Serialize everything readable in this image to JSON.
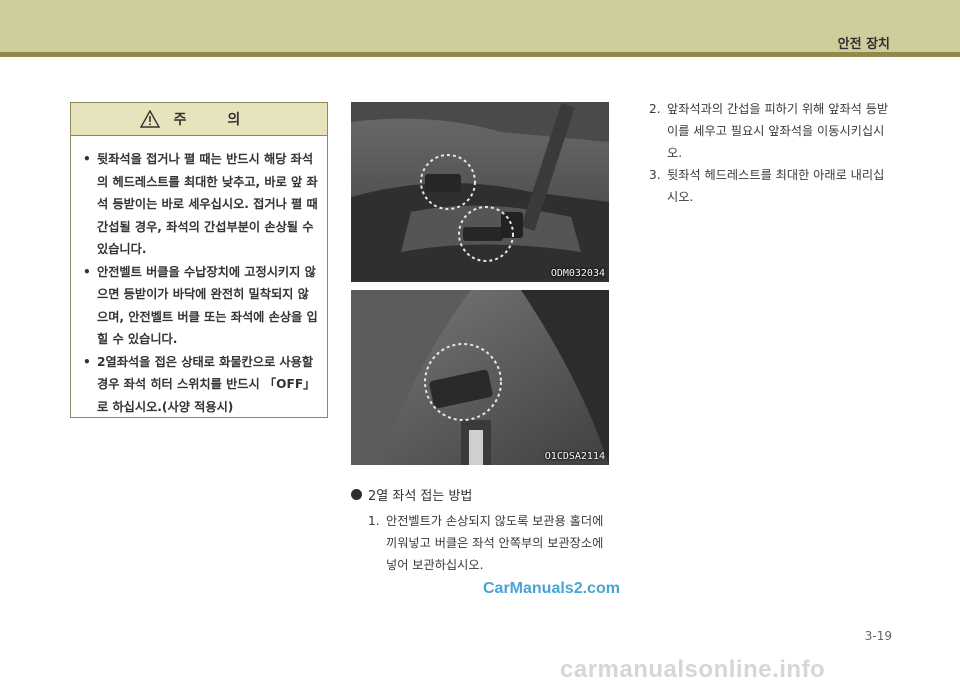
{
  "header": {
    "section_title": "안전 장치"
  },
  "caution": {
    "title": "주 의",
    "items": [
      "뒷좌석을 접거나 펼 때는 반드시 해당 좌석의 헤드레스트를 최대한 낮추고, 바로 앞 좌석 등받이는 바로 세우십시오. 접거나 펼 때 간섭될 경우, 좌석의 간섭부분이 손상될 수 있습니다.",
      "안전벨트 버클을 수납장치에 고정시키지 않으면 등받이가 바닥에 완전히 밀착되지 않으며, 안전벨트 버클 또는 좌석에 손상을 입힐 수 있습니다.",
      "2열좌석을 접은 상태로 화물칸으로 사용할 경우 좌석 히터 스위치를 반드시 「OFF」로 하십시오.(사양 적용시)"
    ]
  },
  "photos": {
    "photo1_code": "ODM032034",
    "photo2_code": "O1CDSA2114"
  },
  "fold_section": {
    "heading": "2열 좌석 접는 방법",
    "steps": [
      {
        "num": "1.",
        "text": "안전벨트가 손상되지 않도록 보관용 홀더에 끼워넣고 버클은 좌석 안쪽부의 보관장소에 넣어 보관하십시오."
      },
      {
        "num": "2.",
        "text": "앞좌석과의 간섭을 피하기 위해 앞좌석 등받이를 세우고 필요시 앞좌석을 이동시키십시오."
      },
      {
        "num": "3.",
        "text": "뒷좌석 헤드레스트를 최대한 아래로 내리십시오."
      }
    ]
  },
  "watermarks": {
    "carmanuals": "CarManuals2.com",
    "online": "carmanualsonline.info"
  },
  "footer": {
    "page_number": "3-19"
  }
}
